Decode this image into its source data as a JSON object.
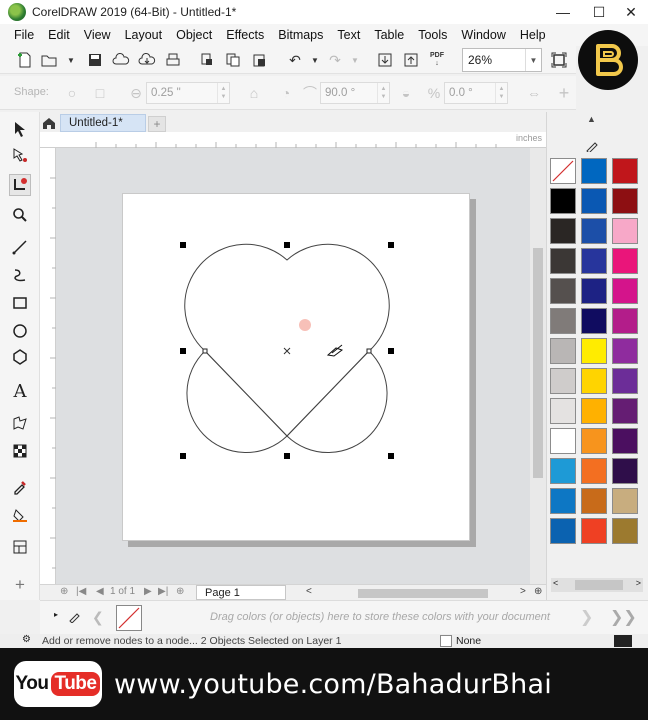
{
  "window": {
    "title": "CorelDRAW 2019 (64-Bit) - Untitled-1*",
    "minimize": "—",
    "maximize": "☐",
    "close": "✕"
  },
  "menu": [
    {
      "label": "File"
    },
    {
      "label": "Edit"
    },
    {
      "label": "View"
    },
    {
      "label": "Layout"
    },
    {
      "label": "Object"
    },
    {
      "label": "Effects"
    },
    {
      "label": "Bitmaps"
    },
    {
      "label": "Text"
    },
    {
      "label": "Table"
    },
    {
      "label": "Tools"
    },
    {
      "label": "Window"
    },
    {
      "label": "Help"
    }
  ],
  "toolbar": {
    "zoom_level": "26%",
    "pdf_label": "PDF"
  },
  "property_bar": {
    "shape_label": "Shape:",
    "outline_width": "0.25 \"",
    "angle_value": "90.0 °",
    "corner_value": "0.0 °"
  },
  "document": {
    "tab_name": "Untitled-1*",
    "add_tab": "+",
    "ruler_units": "inches",
    "page_tab": "Page 1",
    "page_count": "1 of 1"
  },
  "doc_palette": {
    "hint": "Drag colors (or objects) here to store these colors with your document"
  },
  "status": {
    "text": "Add or remove nodes to a node... 2 Objects Selected on Layer 1",
    "fill_label": "None"
  },
  "palette": {
    "colors": [
      "none",
      "#0067c0",
      "#c0161b",
      "#000000",
      "#0a58b3",
      "#8d0f12",
      "#2a2624",
      "#1c4fa8",
      "#f7a8c8",
      "#3b3735",
      "#27359c",
      "#ea157a",
      "#55504e",
      "#1d2284",
      "#d4148b",
      "#807b79",
      "#100c60",
      "#b31d8a",
      "#b9b6b5",
      "#ffec00",
      "#8f2c9e",
      "#cfcccb",
      "#ffd400",
      "#6c2d98",
      "#e4e2e1",
      "#ffb100",
      "#651d73",
      "#ffffff",
      "#f7941d",
      "#4b0f60",
      "#1e9ad6",
      "#f36f21",
      "#2f0e4a",
      "#0d77c4",
      "#c86b1a",
      "#c8ad7f",
      "#0b62b0",
      "#ef4023",
      "#9c7a2f"
    ]
  },
  "banner": {
    "logo_you": "You",
    "logo_tube": "Tube",
    "url": "www.youtube.com/BahadurBhai"
  }
}
